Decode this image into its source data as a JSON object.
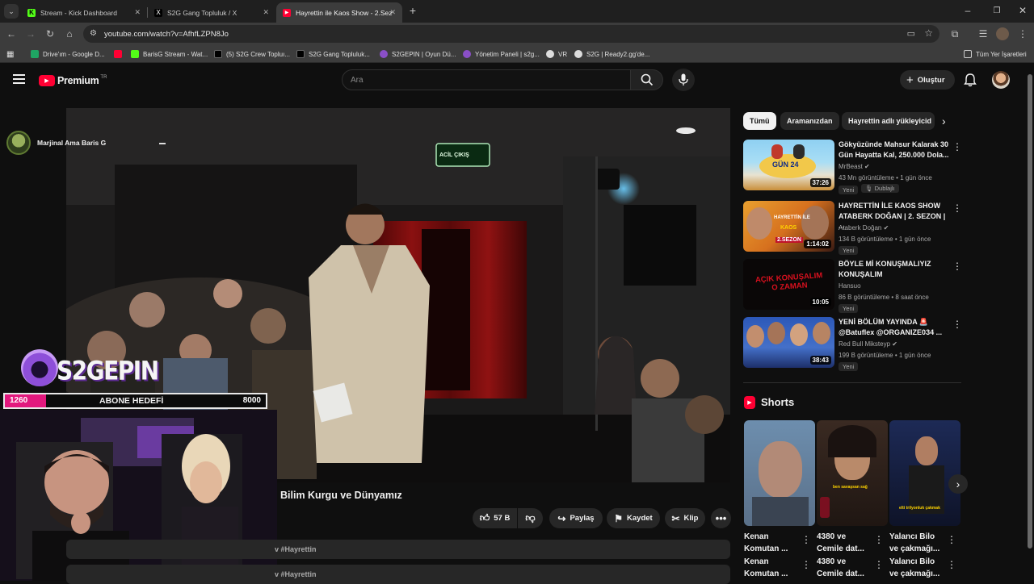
{
  "browser": {
    "tabs": [
      {
        "label": "Stream - Kick Dashboard",
        "favicon_color": "#53fc18",
        "favicon_char": "K"
      },
      {
        "label": "S2G Gang Topluluk / X",
        "favicon_color": "#000000",
        "favicon_char": "X"
      },
      {
        "label": "Hayrettin ile Kaos Show - 2.Sez",
        "favicon_color": "#ff0033",
        "favicon_char": "▶"
      }
    ],
    "url": "youtube.com/watch?v=AfhfLZPN8Jo",
    "bookmarks": [
      {
        "label": "Drive'ım - Google D...",
        "icon_color": "#1fa463"
      },
      {
        "label": "",
        "icon_color": "#ff0033"
      },
      {
        "label": "BarisG Stream - Wat...",
        "icon_color": "#53fc18"
      },
      {
        "label": "(5) S2G Crew Topluı...",
        "icon_color": "#000000"
      },
      {
        "label": "S2G Gang Topluluk...",
        "icon_color": "#000000"
      },
      {
        "label": "S2GEPIN | Oyun Dü...",
        "icon_color": "#8a4fc7"
      },
      {
        "label": "Yönetim Paneli | s2g...",
        "icon_color": "#8a4fc7"
      },
      {
        "label": "VR",
        "icon_color": "#dddddd"
      },
      {
        "label": "S2G | Ready2.gg'de...",
        "icon_color": "#dddddd"
      }
    ],
    "all_bookmarks": "Tüm Yer İşaretleri"
  },
  "youtube": {
    "logo_text": "Premium",
    "logo_sup": "TR",
    "search_placeholder": "Ara",
    "create_label": "Oluştur",
    "video_title": "Bilim Kurgu ve Dünyamız",
    "likes": "57 B",
    "share_label": "Paylaş",
    "save_label": "Kaydet",
    "clip_label": "Klip",
    "desc_rows": [
      "v #Hayrettin",
      "v #Hayrettin"
    ],
    "chips": [
      "Tümü",
      "Aramanızdan",
      "Hayrettin adlı yükleyicid"
    ],
    "recommendations": [
      {
        "title": "Gökyüzünde Mahsur Kalarak 30 Gün Hayatta Kal, 250.000 Dola...",
        "channel": "MrBeast",
        "verified": true,
        "views": "43 Mn görüntüleme",
        "age": "1 gün önce",
        "badge": "Yeni",
        "extra_badge": "Dublajlı",
        "duration": "37:26"
      },
      {
        "title": "HAYRETTİN İLE KAOS SHOW ATABERK DOĞAN | 2. SEZON | ...",
        "channel": "Ataberk Doğan",
        "verified": true,
        "views": "134 B görüntüleme",
        "age": "1 gün önce",
        "badge": "Yeni",
        "duration": "1:14:02"
      },
      {
        "title": "BÖYLE Mİ KONUŞMALIYIZ KONUŞALIM",
        "channel": "Hansuo",
        "verified": false,
        "views": "86 B görüntüleme",
        "age": "8 saat önce",
        "badge": "Yeni",
        "duration": "10:05"
      },
      {
        "title": "YENİ BÖLÜM YAYINDA 🚨 @Batuflex @ORGANIZE034 ...",
        "channel": "Red Bull Miksteyp",
        "verified": true,
        "views": "199 B görüntüleme",
        "age": "1 gün önce",
        "badge": "Yeni",
        "duration": "38:43"
      }
    ],
    "shorts_heading": "Shorts",
    "shorts": [
      {
        "title_lines": [
          "Kenan",
          "Komutan ..."
        ],
        "title_lines_2": [
          "Kenan",
          "Komutan ..."
        ]
      },
      {
        "title_lines": [
          "4380 ve",
          "Cemile dat..."
        ],
        "title_lines_2": [
          "4380 ve",
          "Cemile dat..."
        ],
        "caption": "ben savaşsan sağ"
      },
      {
        "title_lines": [
          "Yalancı Bilo",
          "ve çakmağı..."
        ],
        "title_lines_2": [
          "Yalancı Bilo",
          "ve çakmağı..."
        ],
        "caption": "elti trilyonluk çakmak"
      }
    ],
    "thumb_texts": {
      "rec1": "GÜN 24",
      "rec2_a": "HAYRETTİN İLE",
      "rec2_b": "KAOS",
      "rec2_c": "2.SEZON",
      "rec3": "AÇIK KONUŞALIM O ZAMAN"
    }
  },
  "overlay": {
    "streamer_name": "Marjinal Ama Baris G",
    "brand": "S2GEPIN",
    "goal_current": "1260",
    "goal_label": "ABONE HEDEFİ",
    "goal_target": "8000",
    "goal_progress": 0.1575
  },
  "video_scene": {
    "exit_sign": "ACİL ÇIKIŞ"
  }
}
